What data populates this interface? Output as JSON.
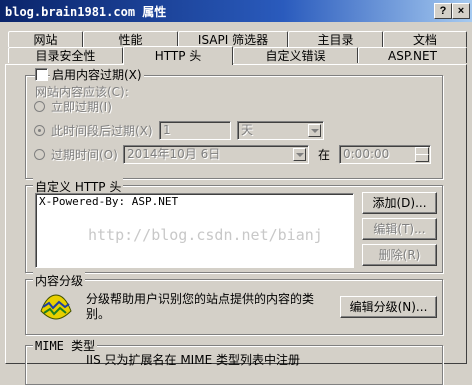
{
  "window": {
    "title": "blog.brain1981.com 属性",
    "help_label": "?",
    "close_label": "×"
  },
  "tabs_row1": [
    {
      "label": "网站"
    },
    {
      "label": "性能"
    },
    {
      "label": "ISAPI 筛选器"
    },
    {
      "label": "主目录"
    },
    {
      "label": "文档"
    }
  ],
  "tabs_row2": [
    {
      "label": "目录安全性"
    },
    {
      "label": "HTTP 头",
      "active": true
    },
    {
      "label": "自定义错误"
    },
    {
      "label": "ASP.NET"
    }
  ],
  "content_expiry": {
    "enable_label": "启用内容过期(X)",
    "enabled": false,
    "should_label": "网站内容应该(C):",
    "expire_now_label": "立即过期(I)",
    "expire_after_label": "此时间段后过期(X)",
    "expire_after_value": "1",
    "expire_after_unit": "天",
    "expire_on_label": "过期时间(O)",
    "expire_on_date": "2014年10月  6日",
    "at_label": "在",
    "expire_on_time": "0:00:00"
  },
  "custom_headers": {
    "legend": "自定义 HTTP 头",
    "items": [
      "X-Powered-By: ASP.NET"
    ],
    "add_label": "添加(D)...",
    "edit_label": "编辑(T)...",
    "delete_label": "删除(R)"
  },
  "content_rating": {
    "legend": "内容分级",
    "description": "分级帮助用户识别您的站点提供的内容的类别。",
    "edit_label": "编辑分级(N)..."
  },
  "mime": {
    "legend": "MIME 类型",
    "description": "IIS 只为扩展名在 MIME 类型列表中注册"
  },
  "watermark": "http://blog.csdn.net/bianj",
  "icons": {
    "rating": "rating-icon"
  }
}
